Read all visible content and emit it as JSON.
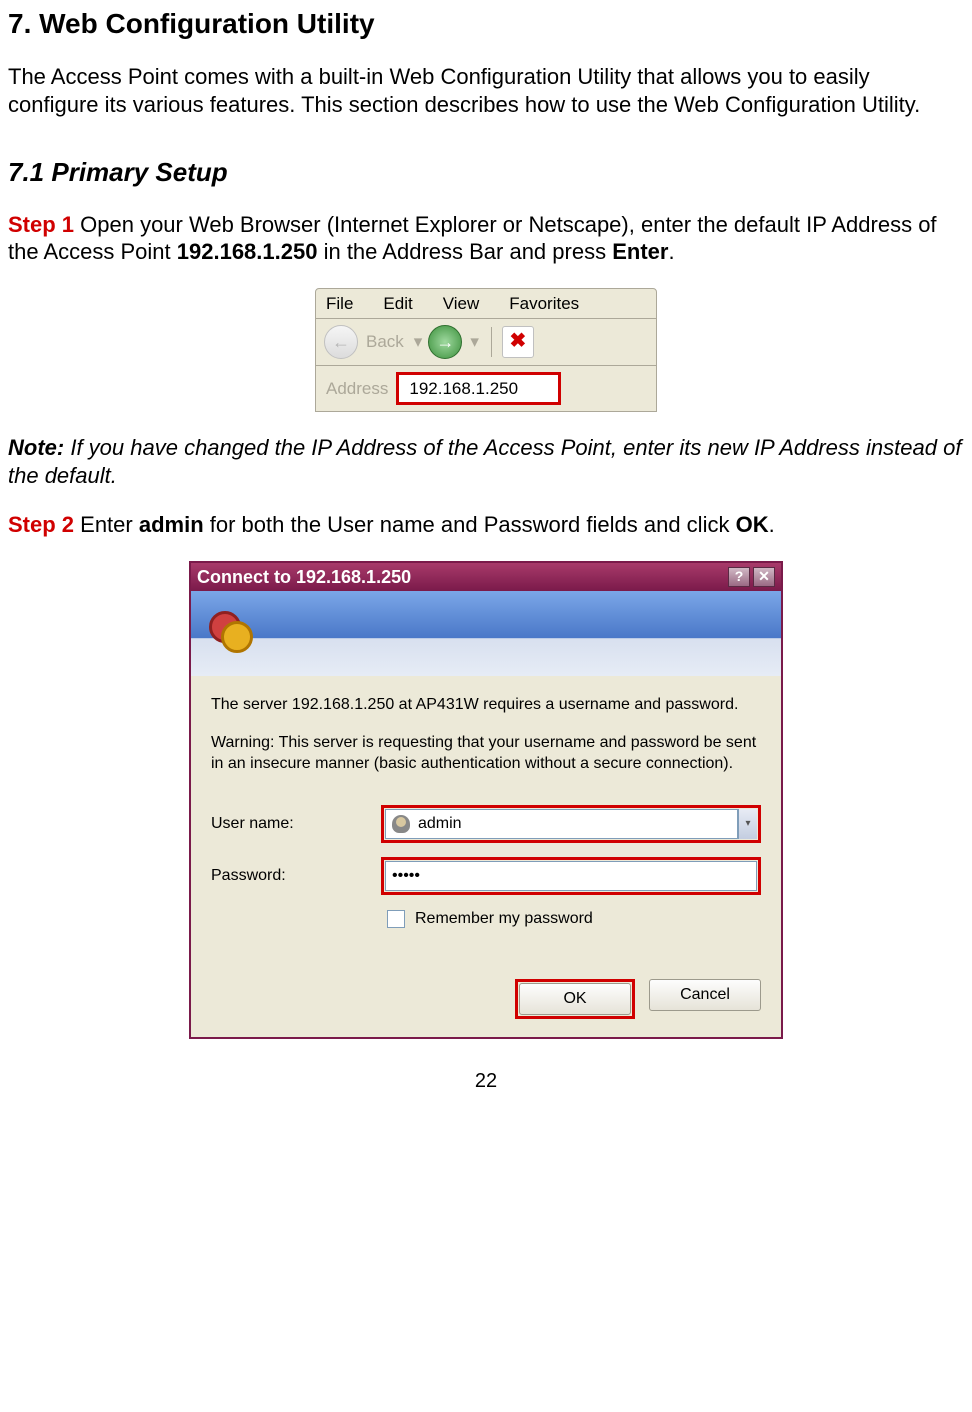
{
  "heading": "7. Web Configuration Utility",
  "intro": "The Access Point comes with a built-in Web Configuration Utility that allows you to easily configure its various features. This section describes how to use the Web Configuration Utility.",
  "subheading": "7.1 Primary Setup",
  "step1": {
    "label": "Step 1",
    "text_a": " Open your Web Browser (Internet Explorer or Netscape), enter the default IP Address of the Access Point ",
    "ip": "192.168.1.250",
    "text_b": " in the Address Bar and press ",
    "enter": "Enter",
    "text_c": "."
  },
  "browser": {
    "menu": {
      "file": "File",
      "edit": "Edit",
      "view": "View",
      "favorites": "Favorites"
    },
    "back": "Back",
    "addr_label": "Address",
    "addr_value": "192.168.1.250"
  },
  "note": {
    "label": "Note:",
    "text": " If you have changed the IP Address of the Access Point, enter its new IP Address instead of the default."
  },
  "step2": {
    "label": "Step 2",
    "text_a": " Enter ",
    "admin": "admin",
    "text_b": " for both the User name and Password fields and click ",
    "ok": "OK",
    "text_c": "."
  },
  "dialog": {
    "title": "Connect to 192.168.1.250",
    "body1": "The server 192.168.1.250 at AP431W requires a username and password.",
    "body2": "Warning: This server is requesting that your username and password be sent in an insecure manner (basic authentication without a secure connection).",
    "user_label": "User name:",
    "user_value": "admin",
    "pass_label": "Password:",
    "pass_value": "•••••",
    "remember": "Remember my password",
    "ok": "OK",
    "cancel": "Cancel"
  },
  "page_number": "22"
}
